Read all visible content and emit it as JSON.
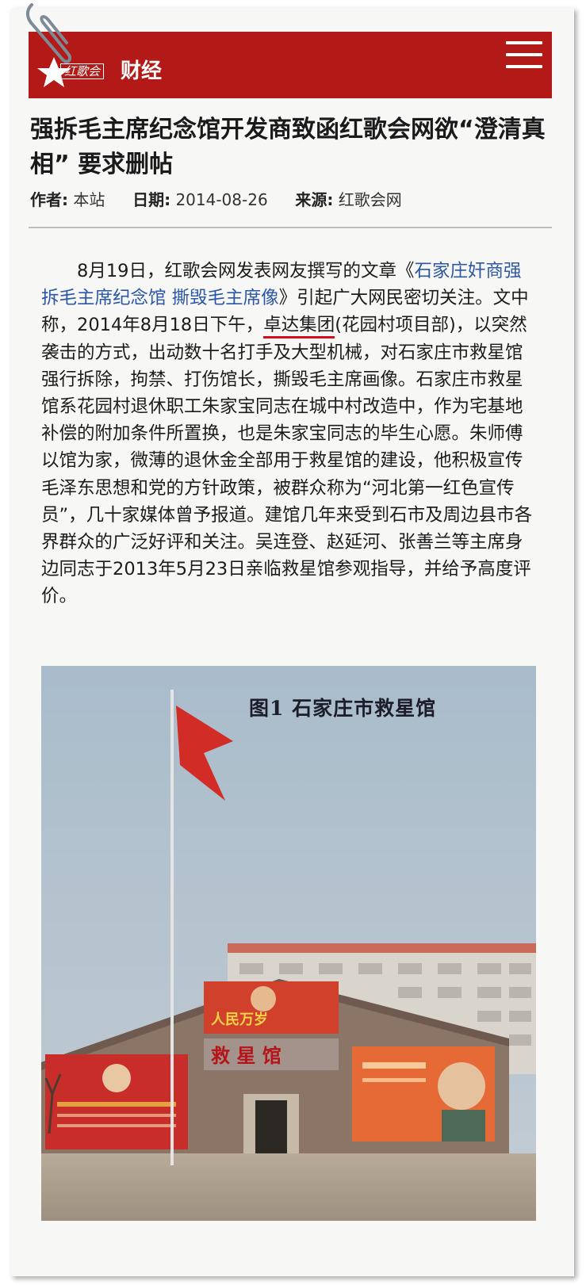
{
  "header": {
    "logo_text": "红歌会",
    "section": "财经"
  },
  "article": {
    "title": "强拆毛主席纪念馆开发商致函红歌会网欲“澄清真相” 要求删帖",
    "meta": {
      "author_label": "作者:",
      "author": "本站",
      "date_label": "日期:",
      "date": "2014-08-26",
      "source_label": "来源:",
      "source": "红歌会网"
    },
    "paragraph": {
      "part1": "　　8月19日，红歌会网发表网友撰写的文章《",
      "link": "石家庄奸商强拆毛主席纪念馆 撕毁毛主席像",
      "part2": "》引起广大网民密切关注。文中称，2014年8月18日下午，",
      "underlined": "卓达集团",
      "part3": "(花园村项目部)，以突然袭击的方式，出动数十名打手及大型机械，对石家庄市救星馆强行拆除，拘禁、打伤馆长，撕毁毛主席画像。石家庄市救星馆系花园村退休职工朱家宝同志在城中村改造中，作为宅基地补偿的附加条件所置换，也是朱家宝同志的毕生心愿。朱师傅以馆为家，微薄的退休金全部用于救星馆的建设，他积极宣传毛泽东思想和党的方针政策，被群众称为“河北第一红色宣传员”，几十家媒体曾予报道。建馆几年来受到石市及周边县市各界群众的广泛好评和关注。吴连登、赵延河、张善兰等主席身边同志于2013年5月23日亲临救星馆参观指导，并给予高度评价。"
    },
    "figure": {
      "caption": "图1  石家庄市救星馆",
      "banner_text": "人民万岁",
      "sign_text": "救  星  馆"
    }
  },
  "colors": {
    "header_bg": "#b31a17",
    "link": "#2b57a6",
    "underline": "#d0101a"
  }
}
